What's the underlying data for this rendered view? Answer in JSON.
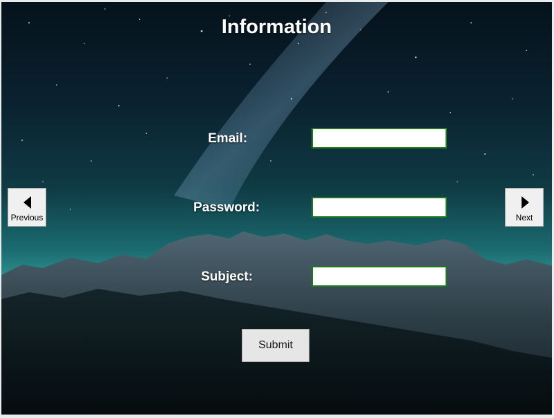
{
  "window": {
    "title": "Information"
  },
  "form": {
    "email_label": "Email:",
    "password_label": "Password:",
    "subject_label": "Subject:",
    "email_value": "",
    "password_value": "",
    "subject_value": "",
    "submit_label": "Submit"
  },
  "navigation": {
    "previous_label": "Previous",
    "next_label": "Next"
  },
  "colors": {
    "field_border": "#1f7a1f",
    "label_text": "#ffffff",
    "button_bg": "#f0f0f0"
  },
  "icons": {
    "previous": "triangle-left-icon",
    "next": "triangle-right-icon"
  }
}
